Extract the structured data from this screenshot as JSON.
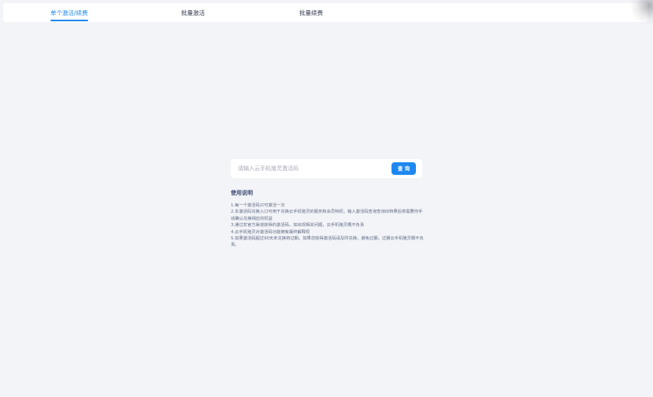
{
  "tabs": [
    {
      "label": "单个激活/续费",
      "active": true
    },
    {
      "label": "批量激活",
      "active": false
    },
    {
      "label": "批量续费",
      "active": false
    }
  ],
  "search": {
    "placeholder": "请输入云手机殖灵激活码",
    "value": "",
    "button_label": "查 询"
  },
  "instructions": {
    "title": "使用说明",
    "items": [
      "1.每一个激活码只可激活一次",
      "2.本激活码兑换入口可用于兑换云手机殖灵的服务和会员特权。输入激活码查询查询出特果后将需要你手动确认兑换相应的权益",
      "3.通过非官方渠道获得的激活码，如出现相关问题，云手机殖灵概不负责",
      "4.云手机殖灵对激活码功能拥有最终解释权",
      "5.如果激活码超过90天未兑换将过期。如果您获得激活码请及时兑换，避免过期。过期云手机殖灵概不负责。"
    ]
  },
  "colors": {
    "accent": "#1e88f0",
    "background": "#f3f4f8",
    "title": "#3d4a73",
    "text": "#5f6a82"
  }
}
